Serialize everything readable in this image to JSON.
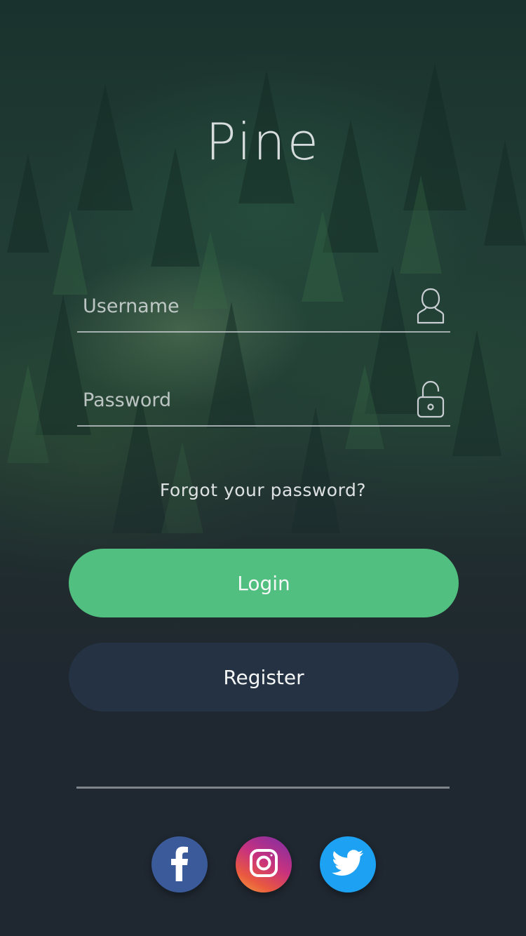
{
  "app": {
    "title": "Pine"
  },
  "form": {
    "username": {
      "placeholder": "Username",
      "value": "",
      "icon": "user-icon"
    },
    "password": {
      "placeholder": "Password",
      "value": "",
      "icon": "unlock-icon"
    },
    "forgot_label": "Forgot your password?"
  },
  "buttons": {
    "login_label": "Login",
    "register_label": "Register"
  },
  "social": [
    {
      "name": "facebook",
      "icon": "facebook-icon",
      "color": "#3b5a9a"
    },
    {
      "name": "instagram",
      "icon": "instagram-icon",
      "color": "#c8327e"
    },
    {
      "name": "twitter",
      "icon": "twitter-icon",
      "color": "#1da1f2"
    }
  ],
  "colors": {
    "accent": "#51bf7f",
    "secondary": "#243244",
    "background": "#1f2730"
  }
}
